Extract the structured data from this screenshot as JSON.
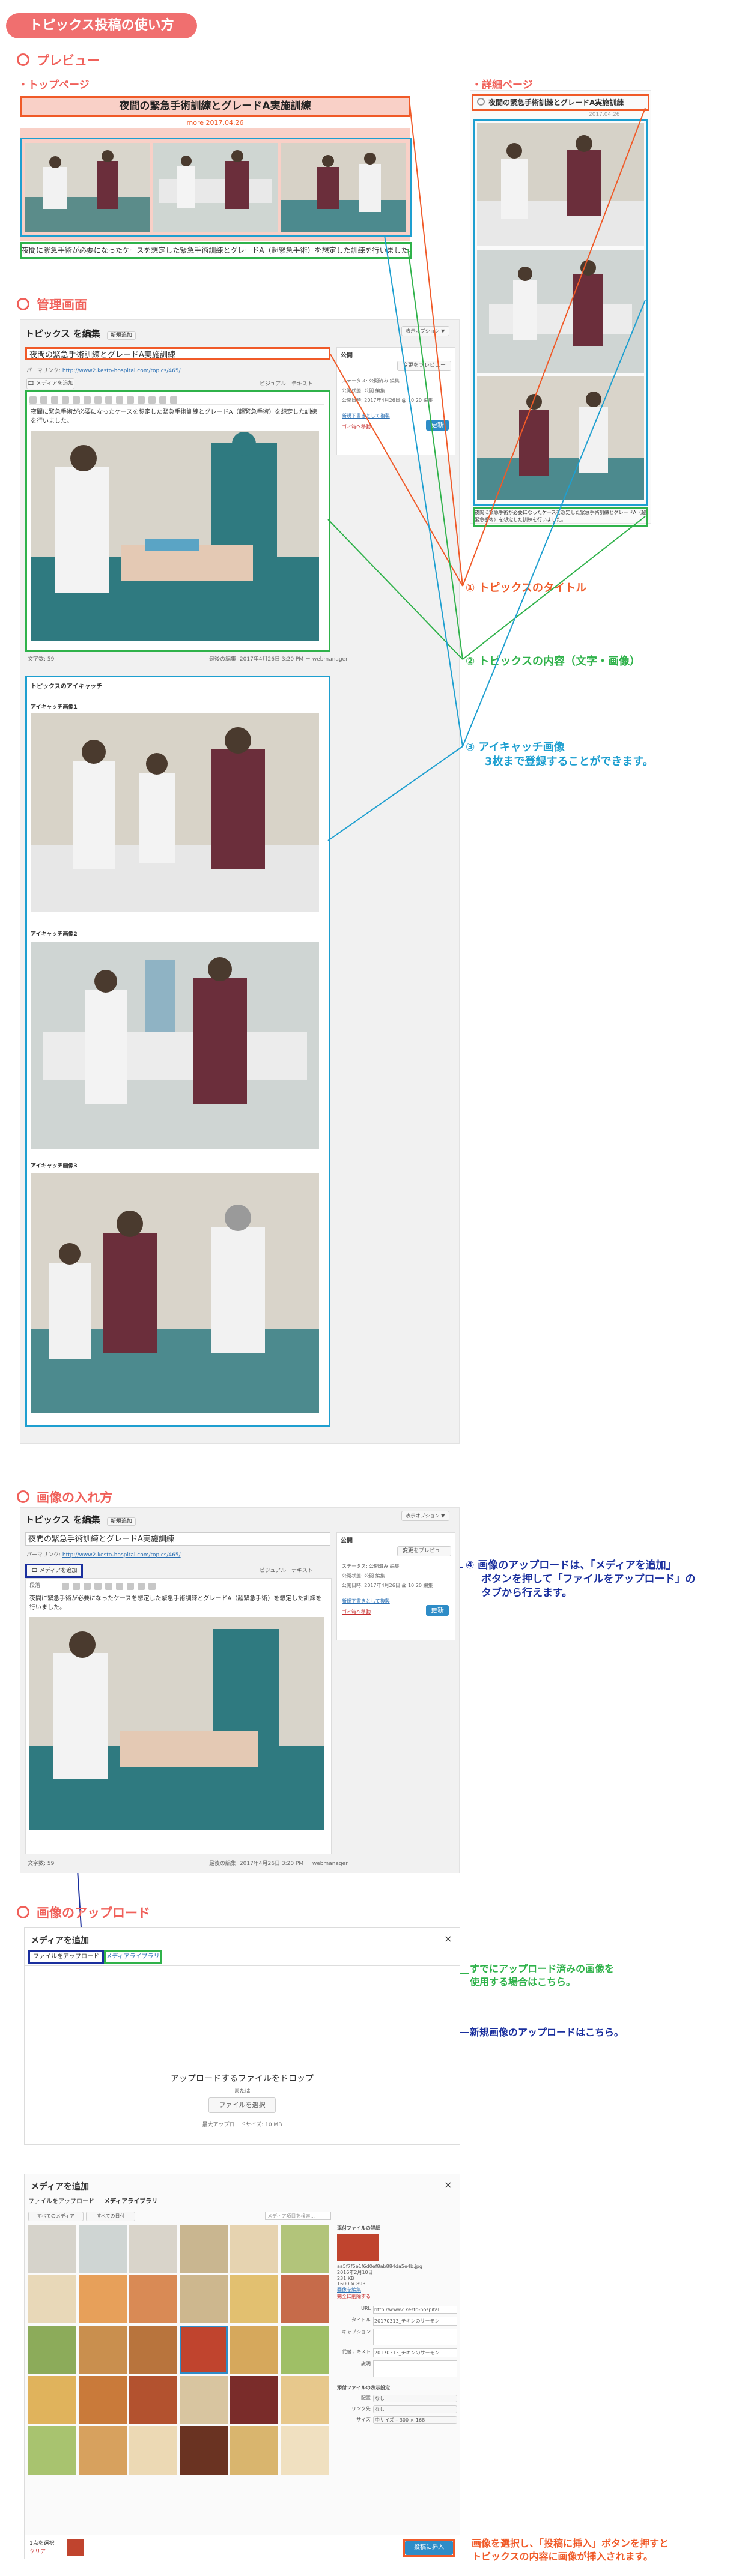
{
  "header": {
    "title": "トピックス投稿の使い方"
  },
  "sections": {
    "preview": "プレビュー",
    "top_page": "・トップページ",
    "detail_page": "・詳細ページ",
    "admin": "管理画面",
    "image_insert": "画像の入れ方",
    "image_upload": "画像のアップロード"
  },
  "preview": {
    "post_title": "夜間の緊急手術訓練とグレードA実施訓練",
    "date": "more 2017.04.26",
    "excerpt": "夜間に緊急手術が必要になったケースを想定した緊急手術訓練とグレードA（超緊急手術）を想定した訓練を行いました。",
    "detail_title": "夜間の緊急手術訓練とグレードA実施訓練",
    "detail_date": "2017.04.26",
    "detail_body": "夜間に緊急手術が必要になったケースを想定した緊急手術訓練とグレードA（超緊急手術）を想定した訓練を行いました。"
  },
  "editor": {
    "heading": "トピックス を編集",
    "new_link": "新規追加",
    "display_options": "表示オプション ▼",
    "title_value": "夜間の緊急手術訓練とグレードA実施訓練",
    "permalink_label": "パーマリンク:",
    "permalink_value": "http://www2.kesto-hospital.com/topics/465/",
    "add_media": "メディアを追加",
    "tab_visual": "ビジュアル",
    "tab_text": "テキスト",
    "paragraph": "段落",
    "body": "夜間に緊急手術が必要になったケースを想定した緊急手術訓練とグレードA（超緊急手術）を想定した訓練を行いました。",
    "word_count": "文字数: 59",
    "last_edited": "最後の編集: 2017年4月26日 3:20 PM － webmanager",
    "publish_box": "公開",
    "preview_changes": "変更をプレビュー",
    "status": "ステータス: 公開済み 編集",
    "visibility": "公開状態: 公開 編集",
    "published_on": "公開日時: 2017年4月26日 @ 10:20 編集",
    "trash": "ゴミ箱へ移動",
    "update": "更新",
    "duplicate": "新規下書きとして複製"
  },
  "eyecatch": {
    "box_title": "トピックスのアイキャッチ",
    "labels": [
      "アイキャッチ画像1",
      "アイキャッチ画像2",
      "アイキャッチ画像3"
    ]
  },
  "annotations": {
    "a1": "① トピックスのタイトル",
    "a2": "② トピックスの内容（文字・画像）",
    "a3_l1": "③ アイキャッチ画像",
    "a3_l2": "3枚まで登録することができます。",
    "a4_l1": "④ 画像のアップロードは、「メディアを追加」",
    "a4_l2": "ボタンを押して「ファイルをアップロード」の",
    "a4_l3": "タブから行えます。",
    "library_l1": "すでにアップロード済みの画像を",
    "library_l2": "使用する場合はこちら。",
    "new_upload": "新規画像のアップロードはこちら。",
    "insert_l1": "画像を選択し、「投稿に挿入」ボタンを押すと",
    "insert_l2": "トピックスの内容に画像が挿入されます。"
  },
  "media_modal": {
    "title": "メディアを追加",
    "close": "×",
    "tab_upload": "ファイルをアップロード",
    "tab_library": "メディアライブラリ",
    "drop_text": "アップロードするファイルをドロップ",
    "or": "または",
    "select_files": "ファイルを選択",
    "max_size": "最大アップロードサイズ: 10 MB"
  },
  "media_library": {
    "title": "メディアを追加",
    "close": "×",
    "filter_all": "すべてのメディア",
    "filter_dates": "すべての日付",
    "search_placeholder": "メディア項目を検索...",
    "details_title": "添付ファイルの詳細",
    "file_name": "aa5f7f5e1f6d0ef8ab884da5e4b.jpg",
    "file_date": "2016年2月10日",
    "file_size": "231 KB",
    "dims": "1600 × 893",
    "edit_link": "画像を編集",
    "delete_link": "完全に削除する",
    "url_label": "URL",
    "url_value": "http://www2.kesto-hospital",
    "title_label": "タイトル",
    "title_value": "20170313_チキンのサーモン",
    "caption_label": "キャプション",
    "alt_label": "代替テキスト",
    "alt_value": "20170313_チキンのサーモン",
    "desc_label": "説明",
    "display_settings": "添付ファイルの表示設定",
    "align_label": "配置",
    "align_value": "なし",
    "link_label": "リンク先",
    "link_value": "なし",
    "size_label": "サイズ",
    "size_value": "中サイズ – 300 × 168",
    "selected_count": "1点を選択",
    "clear": "クリア",
    "insert_button": "投稿に挿入"
  },
  "colors": {
    "accent": "#f06f6f",
    "title_red": "#f05a28",
    "content_green": "#2fb24a",
    "eyecatch_cyan": "#1e9fd0",
    "upload_navy": "#1a2f9e"
  }
}
